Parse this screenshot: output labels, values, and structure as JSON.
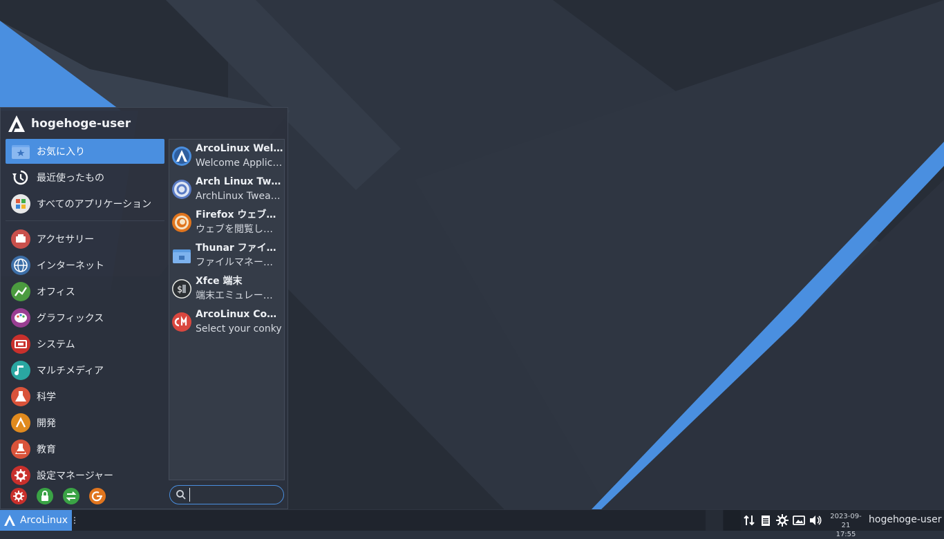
{
  "menu": {
    "username": "hogehoge-user",
    "categories": [
      {
        "label": "お気に入り",
        "icon": "favorites-folder-icon",
        "active": true
      },
      {
        "label": "最近使ったもの",
        "icon": "recent-history-icon"
      },
      {
        "label": "すべてのアプリケーション",
        "icon": "all-applications-icon"
      },
      {
        "label": "アクセサリー",
        "icon": "accessories-icon"
      },
      {
        "label": "インターネット",
        "icon": "internet-globe-icon"
      },
      {
        "label": "オフィス",
        "icon": "office-chart-icon"
      },
      {
        "label": "グラフィックス",
        "icon": "graphics-palette-icon"
      },
      {
        "label": "システム",
        "icon": "system-icon"
      },
      {
        "label": "マルチメディア",
        "icon": "multimedia-icon"
      },
      {
        "label": "科学",
        "icon": "science-flask-icon"
      },
      {
        "label": "開発",
        "icon": "development-icon"
      },
      {
        "label": "教育",
        "icon": "education-flask-icon"
      },
      {
        "label": "設定マネージャー",
        "icon": "settings-gear-icon"
      }
    ],
    "apps": [
      {
        "name": "ArcoLinux Welc…",
        "desc": "Welcome Applic…",
        "icon": "arcolinux-welcome-icon"
      },
      {
        "name": "Arch Linux Twe…",
        "desc": "ArchLinux Twea…",
        "icon": "arch-tweak-icon"
      },
      {
        "name": "Firefox ウェブ・…",
        "desc": "ウェブを閲覧し…",
        "icon": "firefox-icon"
      },
      {
        "name": "Thunar ファイ…",
        "desc": "ファイルマネー…",
        "icon": "thunar-folder-icon"
      },
      {
        "name": "Xfce 端末",
        "desc": "端末エミュレー…",
        "icon": "terminal-icon"
      },
      {
        "name": "ArcoLinux Con…",
        "desc": "Select your conky",
        "icon": "conky-icon"
      }
    ],
    "actions": [
      {
        "icon": "settings-action-icon"
      },
      {
        "icon": "lock-screen-icon"
      },
      {
        "icon": "switch-user-icon"
      },
      {
        "icon": "logout-icon"
      }
    ],
    "search": {
      "value": "",
      "placeholder": ""
    }
  },
  "panel": {
    "start_label": "ArcoLinux",
    "clock_date": "2023-09-21",
    "clock_time": "17:55",
    "user": "hogehoge-user",
    "tray": [
      "network-transfer-icon",
      "clipboard-icon",
      "settings-sun-icon",
      "screenshot-icon",
      "volume-icon"
    ]
  },
  "colors": {
    "accent": "#4a8fe0",
    "menu_bg": "#2c323d",
    "panel_bg": "#1f242d",
    "wallpaper": "#2a313d"
  }
}
